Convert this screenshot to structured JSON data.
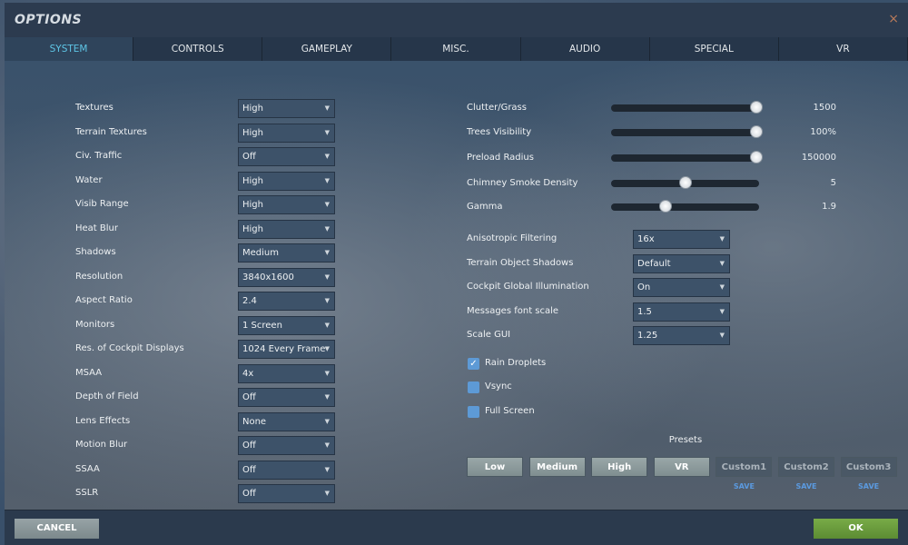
{
  "window": {
    "title": "OPTIONS",
    "close": "×"
  },
  "tabs": [
    "SYSTEM",
    "CONTROLS",
    "GAMEPLAY",
    "MISC.",
    "AUDIO",
    "SPECIAL",
    "VR"
  ],
  "left_settings": [
    {
      "label": "Textures",
      "value": "High"
    },
    {
      "label": "Terrain Textures",
      "value": "High"
    },
    {
      "label": "Civ. Traffic",
      "value": "Off"
    },
    {
      "label": "Water",
      "value": "High"
    },
    {
      "label": "Visib Range",
      "value": "High"
    },
    {
      "label": "Heat Blur",
      "value": "High"
    },
    {
      "label": "Shadows",
      "value": "Medium"
    },
    {
      "label": "Resolution",
      "value": "3840x1600"
    },
    {
      "label": "Aspect Ratio",
      "value": "2.4"
    },
    {
      "label": "Monitors",
      "value": "1 Screen"
    },
    {
      "label": "Res. of Cockpit Displays",
      "value": "1024 Every Frame"
    },
    {
      "label": "MSAA",
      "value": "4x"
    },
    {
      "label": "Depth of Field",
      "value": "Off"
    },
    {
      "label": "Lens Effects",
      "value": "None"
    },
    {
      "label": "Motion Blur",
      "value": "Off"
    },
    {
      "label": "SSAA",
      "value": "Off"
    },
    {
      "label": "SSLR",
      "value": "Off"
    }
  ],
  "sliders": [
    {
      "label": "Clutter/Grass",
      "value": "1500",
      "fraction": 1.0
    },
    {
      "label": "Trees Visibility",
      "value": "100%",
      "fraction": 1.0
    },
    {
      "label": "Preload Radius",
      "value": "150000",
      "fraction": 1.0
    },
    {
      "label": "Chimney Smoke Density",
      "value": "5",
      "fraction": 0.5
    },
    {
      "label": "Gamma",
      "value": "1.9",
      "fraction": 0.36
    }
  ],
  "right_settings": [
    {
      "label": "Anisotropic Filtering",
      "value": "16x"
    },
    {
      "label": "Terrain Object Shadows",
      "value": "Default"
    },
    {
      "label": "Cockpit Global Illumination",
      "value": "On"
    },
    {
      "label": "Messages font scale",
      "value": "1.5"
    },
    {
      "label": "Scale GUI",
      "value": "1.25"
    }
  ],
  "checkboxes": [
    {
      "label": "Rain Droplets",
      "checked": true
    },
    {
      "label": "Vsync",
      "checked": false
    },
    {
      "label": "Full Screen",
      "checked": false
    }
  ],
  "presets": {
    "title": "Presets",
    "buttons": [
      "Low",
      "Medium",
      "High",
      "VR",
      "Custom1",
      "Custom2",
      "Custom3"
    ],
    "save_label": "SAVE"
  },
  "footer": {
    "cancel": "CANCEL",
    "ok": "OK"
  },
  "colors": {
    "active_tab": "#5ec6e6",
    "ok": "#6a9a3e",
    "checkbox": "#5d9ad6"
  }
}
